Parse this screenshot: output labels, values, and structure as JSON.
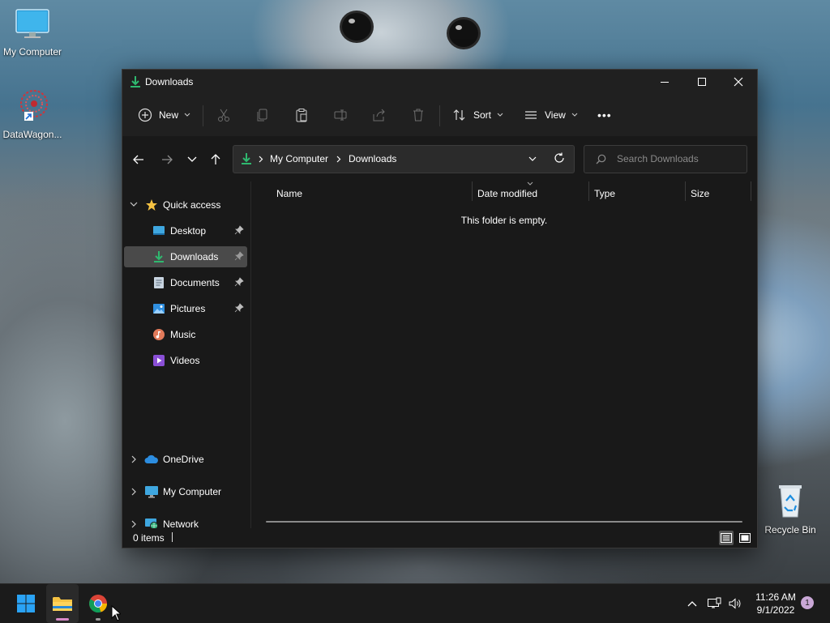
{
  "desktop": {
    "icons": [
      {
        "label": "My Computer",
        "icon": "monitor-icon"
      },
      {
        "label": "DataWagon...",
        "icon": "datawagon-shortcut-icon"
      },
      {
        "label": "Recycle Bin",
        "icon": "recycle-bin-icon"
      }
    ]
  },
  "window": {
    "title": "Downloads",
    "icon": "download-arrow-icon"
  },
  "toolbar": {
    "new_label": "New",
    "sort_label": "Sort",
    "view_label": "View",
    "more_label": "•••"
  },
  "address": {
    "segments": [
      "My Computer",
      "Downloads"
    ],
    "search_placeholder": "Search Downloads"
  },
  "nav": {
    "quick_access": "Quick access",
    "items": [
      {
        "label": "Desktop",
        "icon": "desktop-folder-icon",
        "pinned": true
      },
      {
        "label": "Downloads",
        "icon": "download-arrow-icon",
        "pinned": true,
        "selected": true
      },
      {
        "label": "Documents",
        "icon": "document-icon",
        "pinned": true
      },
      {
        "label": "Pictures",
        "icon": "picture-icon",
        "pinned": true
      },
      {
        "label": "Music",
        "icon": "music-icon",
        "pinned": false
      },
      {
        "label": "Videos",
        "icon": "video-icon",
        "pinned": false
      }
    ],
    "roots": [
      {
        "label": "OneDrive",
        "icon": "cloud-icon"
      },
      {
        "label": "My Computer",
        "icon": "monitor-icon"
      },
      {
        "label": "Network",
        "icon": "network-icon"
      }
    ]
  },
  "content": {
    "columns": [
      "Name",
      "Date modified",
      "Type",
      "Size"
    ],
    "empty_message": "This folder is empty."
  },
  "status": {
    "item_count": "0 items"
  },
  "taskbar": {
    "time": "11:26 AM",
    "date": "9/1/2022",
    "notification_count": "1"
  },
  "colors": {
    "accent_green": "#2fb86f",
    "folder_yellow": "#f5c242",
    "window_bg": "#191919",
    "toolbar_bg": "#202020"
  }
}
